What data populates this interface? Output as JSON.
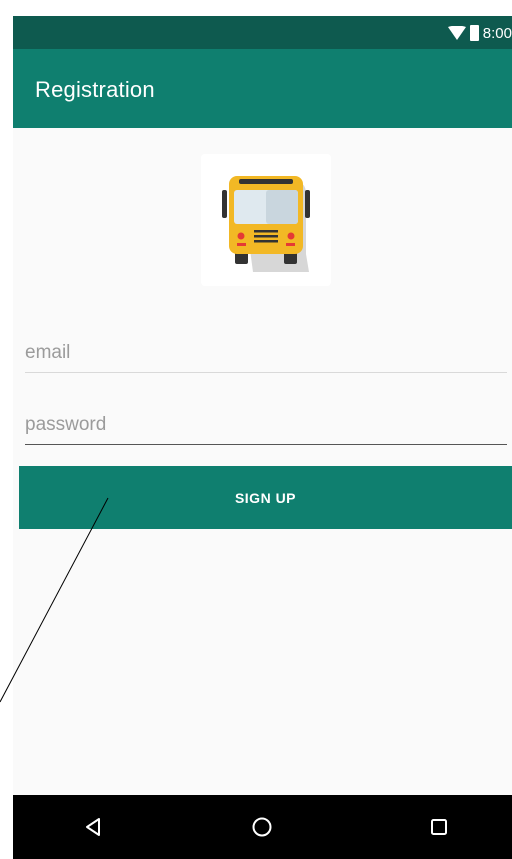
{
  "status_bar": {
    "time": "8:00",
    "icons": [
      "wifi-icon",
      "battery-icon"
    ]
  },
  "app_bar": {
    "title": "Registration"
  },
  "logo": {
    "icon": "school-bus-icon",
    "colors": {
      "body": "#f2b825",
      "window": "#dfe9ef",
      "wheels": "#333333"
    }
  },
  "form": {
    "email_placeholder": "email",
    "email_value": "",
    "password_placeholder": "password",
    "password_value": "",
    "signup_label": "SIGN UP"
  },
  "nav_bar": {
    "buttons": [
      "back-icon",
      "home-icon",
      "recents-icon"
    ]
  },
  "colors": {
    "primary": "#0f7f6f",
    "primary_dark": "#0e5a4f",
    "background": "#fafafa"
  }
}
